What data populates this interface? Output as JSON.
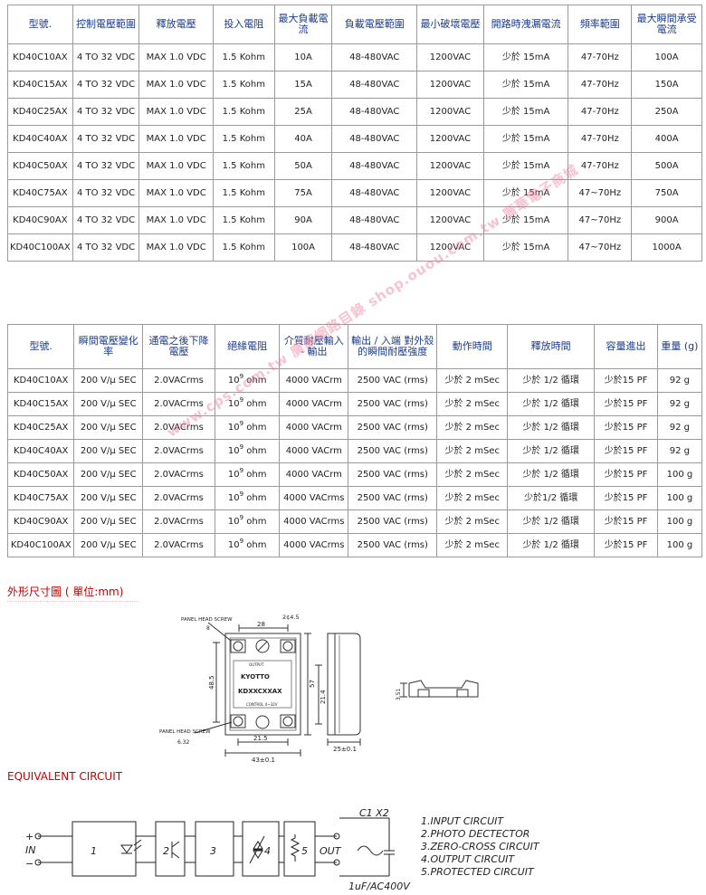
{
  "table1": {
    "headers": [
      "型號.",
      "控制電壓範圍",
      "釋放電壓",
      "投入電阻",
      "最大負載電流",
      "負載電壓範圍",
      "最小破壞電壓",
      "開路時洩漏電流",
      "頻率範圍",
      "最大瞬間承受電流"
    ],
    "rows": [
      [
        "KD40C10AX",
        "4 TO 32 VDC",
        "MAX 1.0 VDC",
        "1.5 Kohm",
        "10A",
        "48-480VAC",
        "1200VAC",
        "少於 15mA",
        "47-70Hz",
        "100A"
      ],
      [
        "KD40C15AX",
        "4 TO 32 VDC",
        "MAX 1.0 VDC",
        "1.5 Kohm",
        "15A",
        "48-480VAC",
        "1200VAC",
        "少於 15mA",
        "47-70Hz",
        "150A"
      ],
      [
        "KD40C25AX",
        "4 TO 32 VDC",
        "MAX 1.0 VDC",
        "1.5 Kohm",
        "25A",
        "48-480VAC",
        "1200VAC",
        "少於 15mA",
        "47-70Hz",
        "250A"
      ],
      [
        "KD40C40AX",
        "4 TO 32 VDC",
        "MAX 1.0 VDC",
        "1.5 Kohm",
        "40A",
        "48-480VAC",
        "1200VAC",
        "少於 15mA",
        "47-70Hz",
        "400A"
      ],
      [
        "KD40C50AX",
        "4 TO 32 VDC",
        "MAX 1.0 VDC",
        "1.5 Kohm",
        "50A",
        "48-480VAC",
        "1200VAC",
        "少於 15mA",
        "47-70Hz",
        "500A"
      ],
      [
        "KD40C75AX",
        "4 TO 32 VDC",
        "MAX 1.0 VDC",
        "1.5 Kohm",
        "75A",
        "48-480VAC",
        "1200VAC",
        "少於 15mA",
        "47~70Hz",
        "750A"
      ],
      [
        "KD40C90AX",
        "4 TO 32 VDC",
        "MAX 1.0 VDC",
        "1.5 Kohm",
        "90A",
        "48-480VAC",
        "1200VAC",
        "少於 15mA",
        "47~70Hz",
        "900A"
      ],
      [
        "KD40C100AX",
        "4 TO 32 VDC",
        "MAX 1.0 VDC",
        "1.5 Kohm",
        "100A",
        "48-480VAC",
        "1200VAC",
        "少於 15mA",
        "47~70Hz",
        "1000A"
      ]
    ]
  },
  "table2": {
    "headers": [
      "型號.",
      "瞬間電壓變化率",
      "通電之後下降電壓",
      "絕緣電阻",
      "介質耐壓輸入 - 輸出",
      "輸出 / 入端 對外殼的瞬間耐壓強度",
      "動作時間",
      "釋放時間",
      "容量進出",
      "重量 (g)"
    ],
    "rows": [
      [
        "KD40C10AX",
        "200 V/μ SEC",
        "2.0VACrms",
        "10",
        "9",
        "ohm",
        "4000 VACrm",
        "2500 VAC (rms)",
        "少於 2 mSec",
        "少於 1/2 循環",
        "少於15 PF",
        "92 g"
      ],
      [
        "KD40C15AX",
        "200 V/μ SEC",
        "2.0VACrms",
        "10",
        "9",
        "ohm",
        "4000 VACrm",
        "2500 VAC (rms)",
        "少於 2 mSec",
        "少於 1/2 循環",
        "少於15 PF",
        "92 g"
      ],
      [
        "KD40C25AX",
        "200 V/μ SEC",
        "2.0VACrms",
        "10",
        "9",
        "ohm",
        "4000 VACrm",
        "2500 VAC (rms)",
        "少於 2 mSec",
        "少於 1/2 循環",
        "少於15 PF",
        "92 g"
      ],
      [
        "KD40C40AX",
        "200 V/μ SEC",
        "2.0VACrms",
        "10",
        "9",
        "ohm",
        "4000 VACrm",
        "2500 VAC (rms)",
        "少於 2 mSec",
        "少於 1/2 循環",
        "少於15 PF",
        "92 g"
      ],
      [
        "KD40C50AX",
        "200 V/μ SEC",
        "2.0VACrms",
        "10",
        "9",
        "ohm",
        "4000 VACrm",
        "2500 VAC (rms)",
        "少於 2 mSec",
        "少於 1/2 循環",
        "少於15 PF",
        "100 g"
      ],
      [
        "KD40C75AX",
        "200 V/μ SEC",
        "2.0VACrms",
        "10",
        "9",
        "ohm",
        "4000 VACrms",
        "2500 VAC (rms)",
        "少於 2 mSec",
        "少於1/2 循環",
        "少於15 PF",
        "100 g"
      ],
      [
        "KD40C90AX",
        "200 V/μ SEC",
        "2.0VACrms",
        "10",
        "9",
        "ohm",
        "4000 VACrms",
        "2500 VAC (rms)",
        "少於 2 mSec",
        "少於 1/2 循環",
        "少於15 PF",
        "100 g"
      ],
      [
        "KD40C100AX",
        "200 V/μ SEC",
        "2.0VACrms",
        "10",
        "9",
        "ohm",
        "4000 VACrms",
        "2500 VAC (rms)",
        "少於 2 mSec",
        "少於 1/2 循環",
        "少於15 PF",
        "100 g"
      ]
    ]
  },
  "watermark": "www.cps.com.tw 廣華網路目錄   shop.ouou.com.tw 廣華電子商城",
  "dims_heading": "外形尺寸圖 ( 單位:mm)",
  "dims": {
    "panel_head_screw": "PANEL HEAD SCREW",
    "panel_head_screw_2": "PANEL HEAD SCREW",
    "w28": "28",
    "hole": "2¢4.5",
    "h48": "48.5",
    "h57": "57",
    "h214": "21.4",
    "w215": "21.5",
    "w43": "43±0.1",
    "w25": "25±0.1",
    "brand": "KYOTTO",
    "model": "KDXXCXXAX",
    "v632": "6.32",
    "v8": "8",
    "v351": "3.51",
    "output": "OUTPUT",
    "control": "CONTROL 4~32V"
  },
  "circuit_heading": "EQUIVALENT CIRCUIT",
  "circuit": {
    "c1": "C1 X2",
    "plus": "+",
    "minus": "−",
    "in": "IN",
    "out": "OUT",
    "cap": "1uF/AC400V",
    "b1": "1",
    "b2": "2",
    "b3": "3",
    "b4": "4",
    "b5": "5",
    "legend": [
      "1.INPUT  CIRCUIT",
      "2.PHOTO  DECTECTOR",
      "3.ZERO-CROSS CIRCUIT",
      "4.OUTPUT  CIRCUIT",
      "5.PROTECTED  CIRCUIT"
    ]
  }
}
